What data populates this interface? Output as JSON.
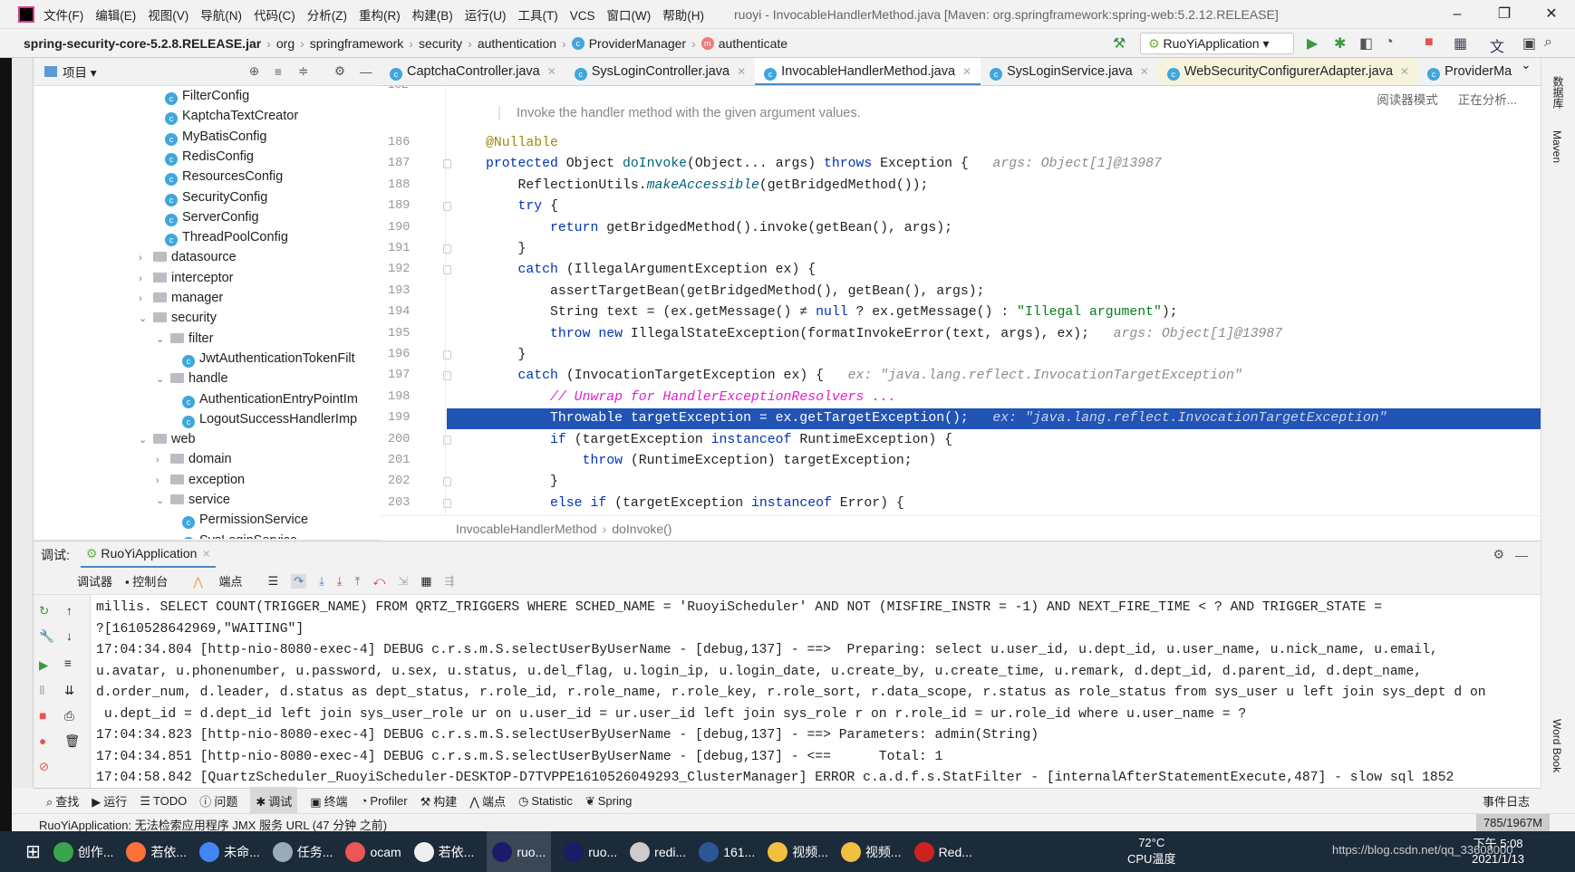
{
  "window": {
    "title": "ruoyi - InvocableHandlerMethod.java [Maven: org.springframework:spring-web:5.2.12.RELEASE]",
    "minimize": "–",
    "restore": "❐",
    "close": "✕"
  },
  "menu": [
    "文件(F)",
    "编辑(E)",
    "视图(V)",
    "导航(N)",
    "代码(C)",
    "分析(Z)",
    "重构(R)",
    "构建(B)",
    "运行(U)",
    "工具(T)",
    "VCS",
    "窗口(W)",
    "帮助(H)"
  ],
  "breadcrumb": [
    "spring-security-core-5.2.8.RELEASE.jar",
    "org",
    "springframework",
    "security",
    "authentication",
    "ProviderManager",
    "authenticate"
  ],
  "toolbar": {
    "run_config": "RuoYiApplication ▾"
  },
  "project": {
    "title": "项目 ▾",
    "tree": [
      {
        "label": "FilterConfig",
        "type": "class",
        "depth": 3
      },
      {
        "label": "KaptchaTextCreator",
        "type": "class",
        "depth": 3
      },
      {
        "label": "MyBatisConfig",
        "type": "class",
        "depth": 3
      },
      {
        "label": "RedisConfig",
        "type": "class",
        "depth": 3
      },
      {
        "label": "ResourcesConfig",
        "type": "class",
        "depth": 3
      },
      {
        "label": "SecurityConfig",
        "type": "class",
        "depth": 3
      },
      {
        "label": "ServerConfig",
        "type": "class",
        "depth": 3
      },
      {
        "label": "ThreadPoolConfig",
        "type": "class",
        "depth": 3
      },
      {
        "label": "datasource",
        "type": "folder",
        "depth": 2,
        "state": "collapsed"
      },
      {
        "label": "interceptor",
        "type": "folder",
        "depth": 2,
        "state": "collapsed"
      },
      {
        "label": "manager",
        "type": "folder",
        "depth": 2,
        "state": "collapsed"
      },
      {
        "label": "security",
        "type": "folder",
        "depth": 2,
        "state": "expanded"
      },
      {
        "label": "filter",
        "type": "folder",
        "depth": 3,
        "state": "expanded"
      },
      {
        "label": "JwtAuthenticationTokenFilt",
        "type": "class",
        "depth": 4
      },
      {
        "label": "handle",
        "type": "folder",
        "depth": 3,
        "state": "expanded"
      },
      {
        "label": "AuthenticationEntryPointIm",
        "type": "class",
        "depth": 4
      },
      {
        "label": "LogoutSuccessHandlerImp",
        "type": "class",
        "depth": 4
      },
      {
        "label": "web",
        "type": "folder",
        "depth": 2,
        "state": "expanded"
      },
      {
        "label": "domain",
        "type": "folder",
        "depth": 3,
        "state": "collapsed"
      },
      {
        "label": "exception",
        "type": "folder",
        "depth": 3,
        "state": "collapsed"
      },
      {
        "label": "service",
        "type": "folder",
        "depth": 3,
        "state": "expanded"
      },
      {
        "label": "PermissionService",
        "type": "class",
        "depth": 4
      },
      {
        "label": "SysLoginService",
        "type": "class",
        "depth": 4
      }
    ]
  },
  "tabs": [
    {
      "label": "CaptchaController.java"
    },
    {
      "label": "SysLoginController.java"
    },
    {
      "label": "InvocableHandlerMethod.java",
      "active": true
    },
    {
      "label": "SysLoginService.java"
    },
    {
      "label": "WebSecurityConfigurerAdapter.java",
      "yellow": true
    },
    {
      "label": "ProviderMa"
    }
  ],
  "editor": {
    "reader_mode": "阅读器模式",
    "analyzing": "正在分析...",
    "doc": "Invoke the handler method with the given argument values.",
    "top_line": "182",
    "current_line": "199",
    "lines": [
      {
        "n": "186",
        "seg": [
          [
            "@Nullable",
            "an"
          ]
        ]
      },
      {
        "n": "187",
        "seg": [
          [
            "protected ",
            "kw"
          ],
          [
            "Object ",
            ""
          ],
          [
            "doInvoke",
            "fn"
          ],
          [
            "(Object... args) ",
            ""
          ],
          [
            "throws ",
            "kw"
          ],
          [
            "Exception {   ",
            ""
          ],
          [
            "args: Object[1]@13987",
            "hint"
          ]
        ]
      },
      {
        "n": "188",
        "seg": [
          [
            "    ReflectionUtils.",
            ""
          ],
          [
            "makeAccessible",
            "it"
          ],
          [
            "(getBridgedMethod());",
            ""
          ]
        ]
      },
      {
        "n": "189",
        "seg": [
          [
            "    ",
            ""
          ],
          [
            "try ",
            "kw"
          ],
          [
            "{",
            ""
          ]
        ]
      },
      {
        "n": "190",
        "seg": [
          [
            "        ",
            ""
          ],
          [
            "return ",
            "kw"
          ],
          [
            "getBridgedMethod().invoke(getBean(), args);",
            ""
          ]
        ]
      },
      {
        "n": "191",
        "seg": [
          [
            "    }",
            ""
          ]
        ]
      },
      {
        "n": "192",
        "seg": [
          [
            "    ",
            ""
          ],
          [
            "catch ",
            "kw"
          ],
          [
            "(IllegalArgumentException ex) {",
            ""
          ]
        ]
      },
      {
        "n": "193",
        "seg": [
          [
            "        assertTargetBean(getBridgedMethod(), getBean(), args);",
            ""
          ]
        ]
      },
      {
        "n": "194",
        "seg": [
          [
            "        String text = (ex.getMessage() ≠ ",
            ""
          ],
          [
            "null ",
            "kw"
          ],
          [
            "? ex.getMessage() : ",
            ""
          ],
          [
            "\"Illegal argument\"",
            "st"
          ],
          [
            ");",
            ""
          ]
        ]
      },
      {
        "n": "195",
        "seg": [
          [
            "        ",
            ""
          ],
          [
            "throw new ",
            "kw"
          ],
          [
            "IllegalStateException(formatInvokeError(text, args), ex);   ",
            ""
          ],
          [
            "args: Object[1]@13987",
            "hint"
          ]
        ]
      },
      {
        "n": "196",
        "seg": [
          [
            "    }",
            ""
          ]
        ]
      },
      {
        "n": "197",
        "seg": [
          [
            "    ",
            ""
          ],
          [
            "catch ",
            "kw"
          ],
          [
            "(InvocationTargetException ex) {   ",
            ""
          ],
          [
            "ex: \"java.lang.reflect.InvocationTargetException\"",
            "hint"
          ]
        ]
      },
      {
        "n": "198",
        "seg": [
          [
            "        ",
            ""
          ],
          [
            "// Unwrap for HandlerExceptionResolvers ...",
            "cm"
          ]
        ]
      },
      {
        "n": "199",
        "seg": [
          [
            "        Throwable targetException = ex.getTargetException();   ",
            ""
          ],
          [
            "ex: \"java.lang.reflect.InvocationTargetException\"",
            "hint"
          ]
        ]
      },
      {
        "n": "200",
        "seg": [
          [
            "        ",
            ""
          ],
          [
            "if ",
            "kw"
          ],
          [
            "(targetException ",
            ""
          ],
          [
            "instanceof ",
            "kw"
          ],
          [
            "RuntimeException) {",
            ""
          ]
        ]
      },
      {
        "n": "201",
        "seg": [
          [
            "            ",
            ""
          ],
          [
            "throw ",
            "kw"
          ],
          [
            "(RuntimeException) targetException;",
            ""
          ]
        ]
      },
      {
        "n": "202",
        "seg": [
          [
            "        }",
            ""
          ]
        ]
      },
      {
        "n": "203",
        "seg": [
          [
            "        ",
            ""
          ],
          [
            "else if ",
            "kw"
          ],
          [
            "(targetException ",
            ""
          ],
          [
            "instanceof ",
            "kw"
          ],
          [
            "Error) {",
            ""
          ]
        ]
      }
    ],
    "breadcrumb": [
      "InvocableHandlerMethod",
      "doInvoke()"
    ]
  },
  "debug": {
    "label": "调试:",
    "session": "RuoYiApplication",
    "tabs": [
      "调试器",
      "控制台",
      "端点"
    ],
    "console": [
      "millis. SELECT COUNT(TRIGGER_NAME) FROM QRTZ_TRIGGERS WHERE SCHED_NAME = 'RuoyiScheduler' AND NOT (MISFIRE_INSTR = -1) AND NEXT_FIRE_TIME < ? AND TRIGGER_STATE =",
      "?[1610528642969,\"WAITING\"]",
      "17:04:34.804 [http-nio-8080-exec-4] DEBUG c.r.s.m.S.selectUserByUserName - [debug,137] - ==>  Preparing: select u.user_id, u.dept_id, u.user_name, u.nick_name, u.email,",
      "u.avatar, u.phonenumber, u.password, u.sex, u.status, u.del_flag, u.login_ip, u.login_date, u.create_by, u.create_time, u.remark, d.dept_id, d.parent_id, d.dept_name,",
      "d.order_num, d.leader, d.status as dept_status, r.role_id, r.role_name, r.role_key, r.role_sort, r.data_scope, r.status as role_status from sys_user u left join sys_dept d on",
      " u.dept_id = d.dept_id left join sys_user_role ur on u.user_id = ur.user_id left join sys_role r on r.role_id = ur.role_id where u.user_name = ?",
      "17:04:34.823 [http-nio-8080-exec-4] DEBUG c.r.s.m.S.selectUserByUserName - [debug,137] - ==> Parameters: admin(String)",
      "17:04:34.851 [http-nio-8080-exec-4] DEBUG c.r.s.m.S.selectUserByUserName - [debug,137] - <==      Total: 1",
      "17:04:58.842 [QuartzScheduler_RuoyiScheduler-DESKTOP-D7TVPPE1610526049293_ClusterManager] ERROR c.a.d.f.s.StatFilter - [internalAfterStatementExecute,487] - slow sql 1852"
    ]
  },
  "bottom_tools": [
    "查找",
    "运行",
    "TODO",
    "问题",
    "调试",
    "终端",
    "Profiler",
    "构建",
    "端点",
    "Statistic",
    "Spring"
  ],
  "event_log": "事件日志",
  "right_strip": [
    "数据库",
    "Maven",
    "Word Book"
  ],
  "status": {
    "message": "RuoYiApplication: 无法检索应用程序 JMX 服务 URL (47 分钟 之前)",
    "memory": "785/1967M"
  },
  "taskbar": {
    "apps": [
      "创作...",
      "若依...",
      "未命...",
      "任务...",
      "ocam",
      "若依...",
      "ruo...",
      "ruo...",
      "redi...",
      "161...",
      "视频...",
      "视频...",
      "Red..."
    ],
    "temp": "72°C",
    "temp_label": "CPU温度",
    "time": "下午 5:08",
    "date": "2021/1/13",
    "watermark": "https://blog.csdn.net/qq_33608000"
  },
  "colors": {
    "accent": "#4a88c7",
    "current_line": "#2154b5",
    "keyword": "#0033b3",
    "string": "#067d17"
  }
}
